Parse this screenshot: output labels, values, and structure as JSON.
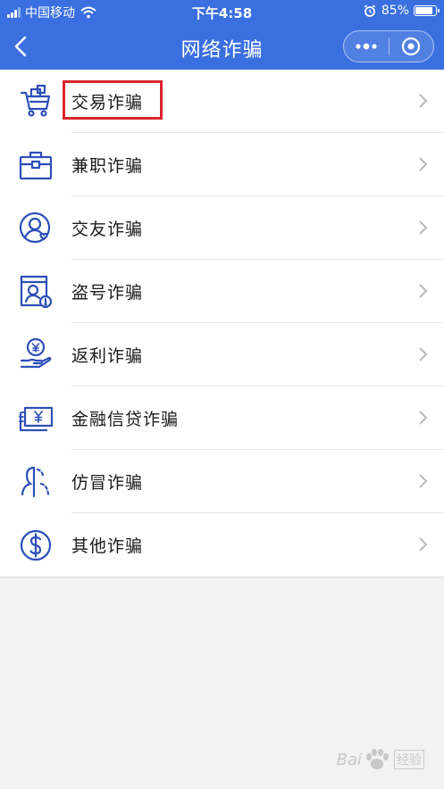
{
  "status_bar": {
    "carrier": "中国移动",
    "time": "下午4:58",
    "battery": "85%",
    "battery_level": 0.85
  },
  "nav": {
    "title": "网络诈骗"
  },
  "items": [
    {
      "label": "交易诈骗",
      "icon": "shopping-cart-icon"
    },
    {
      "label": "兼职诈骗",
      "icon": "briefcase-icon"
    },
    {
      "label": "交友诈骗",
      "icon": "user-heart-icon"
    },
    {
      "label": "盗号诈骗",
      "icon": "account-warning-icon"
    },
    {
      "label": "返利诈骗",
      "icon": "hand-coin-icon"
    },
    {
      "label": "金融信贷诈骗",
      "icon": "money-bill-icon"
    },
    {
      "label": "仿冒诈骗",
      "icon": "impersonation-icon"
    },
    {
      "label": "其他诈骗",
      "icon": "dollar-circle-icon"
    }
  ],
  "colors": {
    "brand": "#3a6fe0",
    "icon": "#2b4fb8",
    "highlight": "#d9262c"
  },
  "watermark": {
    "brand": "Bai",
    "suffix": "经验"
  }
}
